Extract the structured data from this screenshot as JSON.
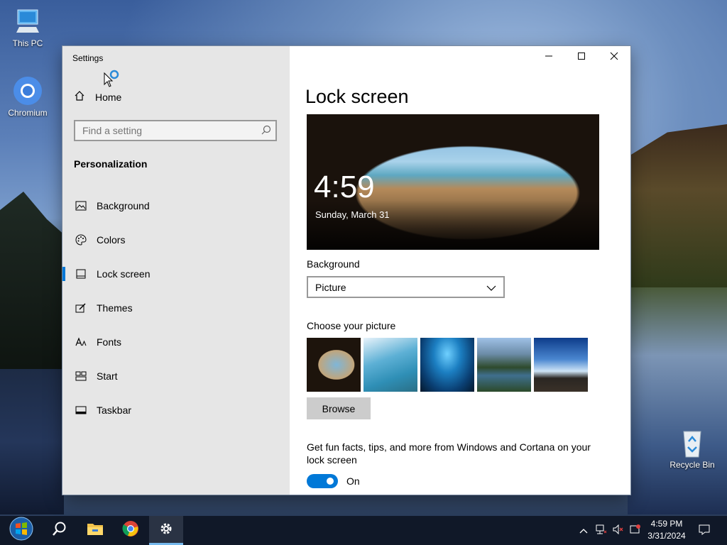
{
  "desktop": {
    "icons": [
      {
        "label": "This PC",
        "icon": "computer-icon"
      },
      {
        "label": "Chromium",
        "icon": "chromium-icon"
      },
      {
        "label": "Recycle Bin",
        "icon": "recycle-bin-icon"
      }
    ]
  },
  "window": {
    "title": "Settings",
    "caption": {
      "minimize": "minimize-icon",
      "maximize": "maximize-icon",
      "close": "close-icon"
    }
  },
  "sidebar": {
    "home_label": "Home",
    "search_placeholder": "Find a setting",
    "section": "Personalization",
    "items": [
      {
        "label": "Background",
        "icon": "picture-icon"
      },
      {
        "label": "Colors",
        "icon": "palette-icon"
      },
      {
        "label": "Lock screen",
        "icon": "lock-screen-icon",
        "active": true
      },
      {
        "label": "Themes",
        "icon": "brush-icon"
      },
      {
        "label": "Fonts",
        "icon": "fonts-icon"
      },
      {
        "label": "Start",
        "icon": "start-layout-icon"
      },
      {
        "label": "Taskbar",
        "icon": "taskbar-icon"
      }
    ]
  },
  "content": {
    "title": "Lock screen",
    "preview": {
      "time": "4:59",
      "date": "Sunday, March 31"
    },
    "background_label": "Background",
    "background_value": "Picture",
    "choose_picture_label": "Choose your picture",
    "browse_label": "Browse",
    "fun_facts_text": "Get fun facts, tips, and more from Windows and Cortana on your lock screen",
    "fun_facts_toggle": "On",
    "fun_facts_enabled": true
  },
  "taskbar": {
    "items": [
      "start-button",
      "search-icon",
      "file-explorer-icon",
      "chrome-icon",
      "settings-icon"
    ],
    "clock_time": "4:59 PM",
    "clock_date": "3/31/2024",
    "accent": "#0078d7"
  }
}
